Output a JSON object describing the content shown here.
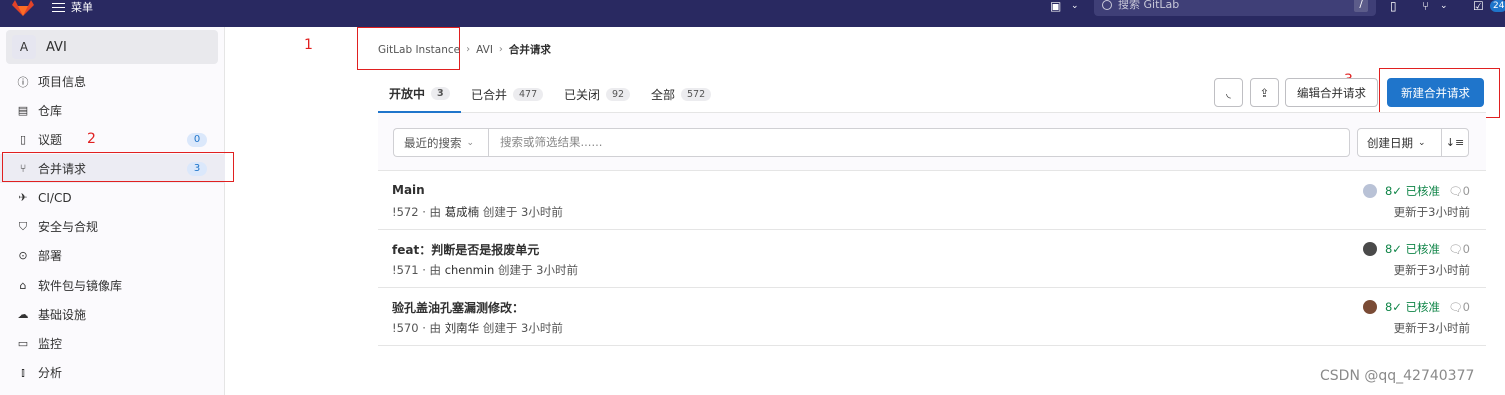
{
  "topbar": {
    "menu_label": "菜单",
    "search_placeholder": "搜索 GitLab",
    "search_shortcut": "/",
    "todo_count": "24"
  },
  "sidebar": {
    "project_initial": "A",
    "project_name": "AVI",
    "items": [
      {
        "label": "项目信息",
        "icon": "info-icon"
      },
      {
        "label": "仓库",
        "icon": "repository-icon"
      },
      {
        "label": "议题",
        "icon": "issues-icon",
        "count": "0"
      },
      {
        "label": "合并请求",
        "icon": "merge-request-icon",
        "count": "3"
      },
      {
        "label": "CI/CD",
        "icon": "rocket-icon"
      },
      {
        "label": "安全与合规",
        "icon": "shield-icon"
      },
      {
        "label": "部署",
        "icon": "deployments-icon"
      },
      {
        "label": "软件包与镜像库",
        "icon": "package-icon"
      },
      {
        "label": "基础设施",
        "icon": "cloud-gear-icon"
      },
      {
        "label": "监控",
        "icon": "monitor-icon"
      },
      {
        "label": "分析",
        "icon": "chart-icon"
      }
    ]
  },
  "annotations": [
    "1",
    "2",
    "3"
  ],
  "breadcrumb": {
    "items": [
      "GitLab Instance",
      "AVI"
    ],
    "current": "合并请求"
  },
  "tabs": [
    {
      "label": "开放中",
      "count": "3"
    },
    {
      "label": "已合并",
      "count": "477"
    },
    {
      "label": "已关闭",
      "count": "92"
    },
    {
      "label": "全部",
      "count": "572"
    }
  ],
  "actions": {
    "edit": "编辑合并请求",
    "new": "新建合并请求"
  },
  "filter": {
    "recent": "最近的搜索",
    "placeholder": "搜索或筛选结果......",
    "sort": "创建日期"
  },
  "merge_requests": [
    {
      "title": "Main",
      "meta_prefix": "!572 · 由",
      "author": "葛成楠",
      "meta_suffix": "创建于 3小时前",
      "approved": "已核准",
      "comments": "0",
      "updated": "更新于3小时前",
      "avatar_color": "#b9c2d6"
    },
    {
      "title": "feat：判断是否是报废单元",
      "meta_prefix": "!571 · 由",
      "author": "chenmin",
      "meta_suffix": "创建于 3小时前",
      "approved": "已核准",
      "comments": "0",
      "updated": "更新于3小时前",
      "avatar_color": "#4a4a4a"
    },
    {
      "title": "验孔盖油孔塞漏测修改：",
      "meta_prefix": "!570 · 由",
      "author": "刘南华",
      "meta_suffix": "创建于 3小时前",
      "approved": "已核准",
      "comments": "0",
      "updated": "更新于3小时前",
      "avatar_color": "#7a4b35"
    }
  ],
  "watermark": "CSDN @qq_42740377",
  "colors": {
    "topbar": "#292961",
    "primary": "#1f75cb",
    "approved": "#108548",
    "annotation": "#e02020"
  }
}
